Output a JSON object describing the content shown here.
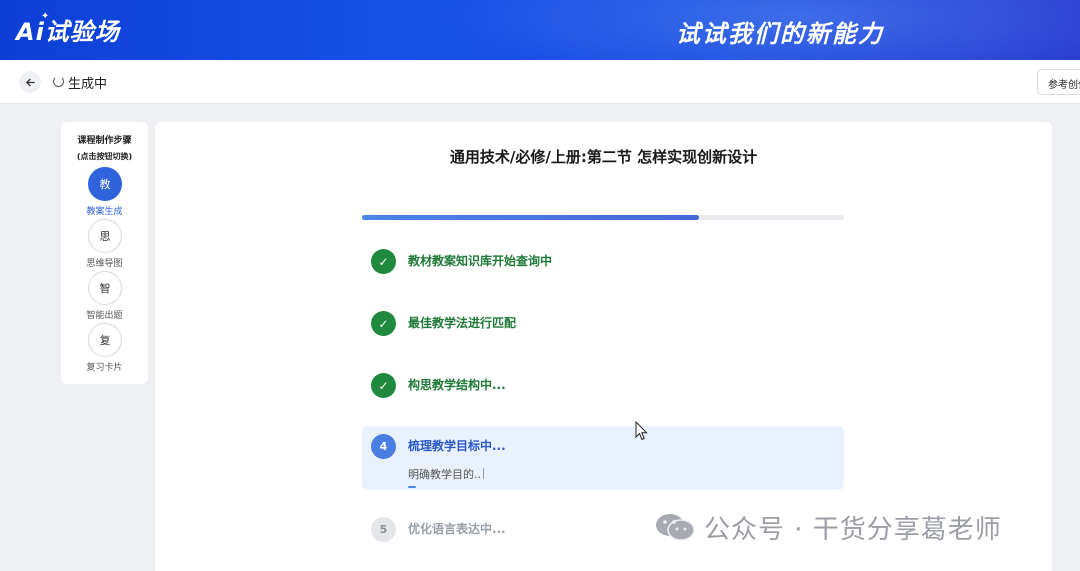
{
  "banner": {
    "logo_text": "Ai试验场",
    "slogan": "试试我们的新能力",
    "bg_color": "#1650e6"
  },
  "topbar": {
    "back_icon": "arrow-left-icon",
    "status": "生成中",
    "reference_button": "参考创作"
  },
  "sidebar": {
    "title": "课程制作步骤",
    "subtitle": "(点击按钮切换)",
    "steps": [
      {
        "glyph": "教",
        "label": "教案生成",
        "active": true
      },
      {
        "glyph": "思",
        "label": "思维导图",
        "active": false
      },
      {
        "glyph": "智",
        "label": "智能出题",
        "active": false
      },
      {
        "glyph": "复",
        "label": "复习卡片",
        "active": false
      }
    ]
  },
  "main": {
    "title": "通用技术/必修/上册:第二节 怎样实现创新设计",
    "progress_fraction": 0.7,
    "tasks": [
      {
        "badge": "✓",
        "label": "教材教案知识库开始查询中",
        "state": "done"
      },
      {
        "badge": "✓",
        "label": "最佳教学法进行匹配",
        "state": "done"
      },
      {
        "badge": "✓",
        "label": "构思教学结构中...",
        "state": "done"
      },
      {
        "badge": "4",
        "label": "梳理教学目标中...",
        "state": "active",
        "sub": "明确教学目的.."
      },
      {
        "badge": "5",
        "label": "优化语言表达中...",
        "state": "pending"
      }
    ]
  },
  "watermark": {
    "text": "公众号 · 干货分享葛老师"
  },
  "colors": {
    "accent": "#2f63dc",
    "done": "#1f8a3d",
    "active_bg": "#e9f1fc"
  }
}
